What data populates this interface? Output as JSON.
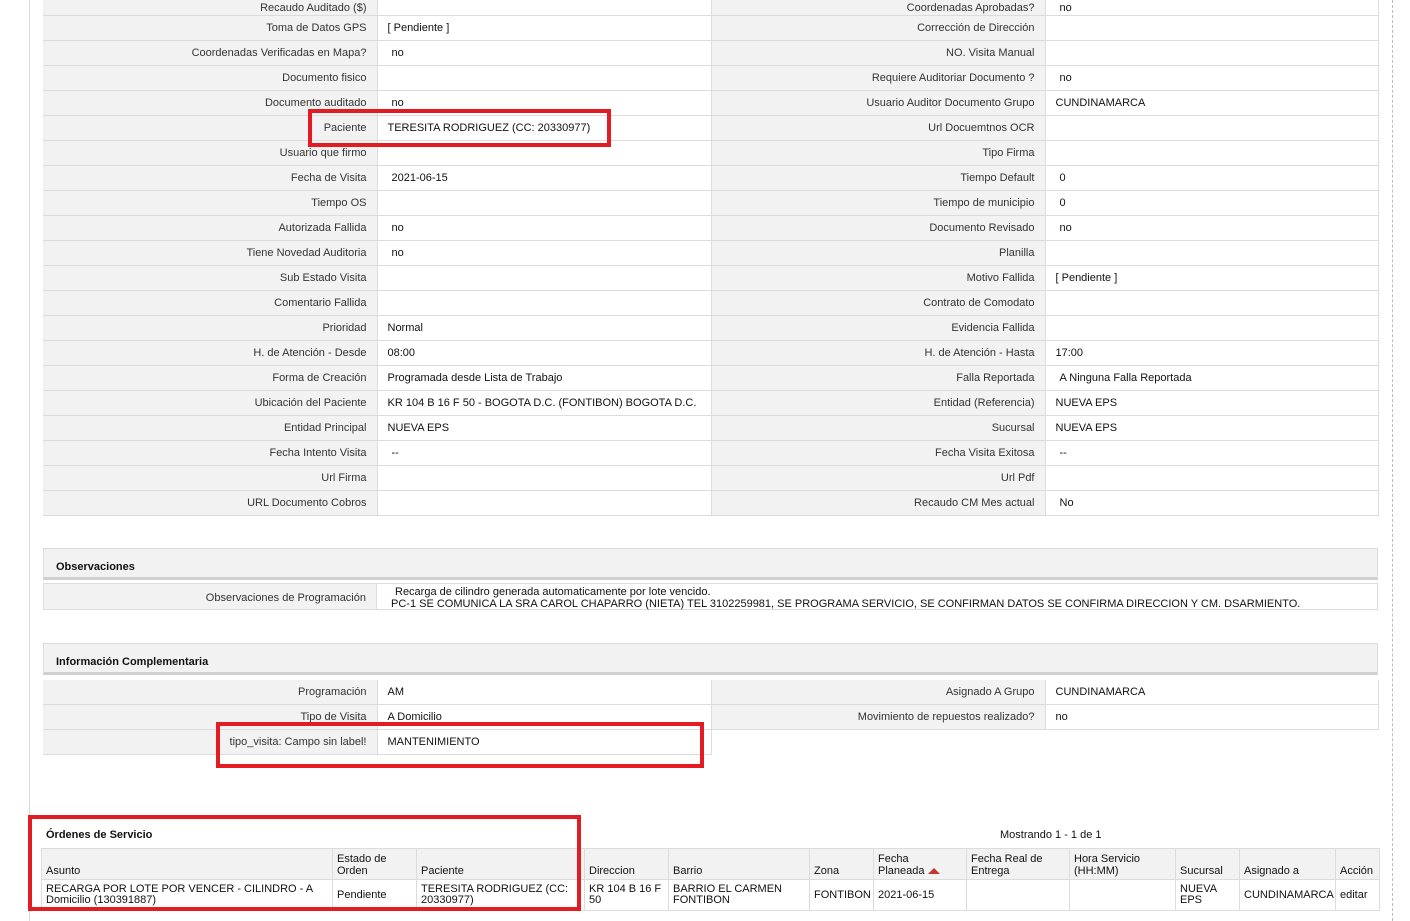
{
  "detail_rows": [
    {
      "l1": "Recaudo Auditado ($)",
      "v1": "",
      "l2": "Coordenadas Aprobadas?",
      "v2": "no"
    },
    {
      "l1": "Toma de Datos GPS",
      "v1": "[ Pendiente ]",
      "l2": "Corrección de Dirección",
      "v2": ""
    },
    {
      "l1": "Coordenadas Verificadas en Mapa?",
      "v1": "no",
      "l2": "NO. Visita Manual",
      "v2": ""
    },
    {
      "l1": "Documento fisico",
      "v1": "",
      "l2": "Requiere Auditoriar Documento ?",
      "v2": "no"
    },
    {
      "l1": "Documento auditado",
      "v1": "no",
      "l2": "Usuario Auditor Documento Grupo",
      "v2": "CUNDINAMARCA"
    },
    {
      "l1": "Paciente",
      "v1": "TERESITA RODRIGUEZ (CC: 20330977)",
      "l2": "Url Docuemtnos OCR",
      "v2": ""
    },
    {
      "l1": "Usuario que firmo",
      "v1": "",
      "l2": "Tipo Firma",
      "v2": ""
    },
    {
      "l1": "Fecha de Visita",
      "v1": "2021-06-15",
      "l2": "Tiempo Default",
      "v2": "0"
    },
    {
      "l1": "Tiempo OS",
      "v1": "",
      "l2": "Tiempo de municipio",
      "v2": "0"
    },
    {
      "l1": "Autorizada Fallida",
      "v1": "no",
      "l2": "Documento Revisado",
      "v2": "no"
    },
    {
      "l1": "Tiene Novedad Auditoria",
      "v1": "no",
      "l2": "Planilla",
      "v2": ""
    },
    {
      "l1": "Sub Estado Visita",
      "v1": "",
      "l2": "Motivo Fallida",
      "v2": "[ Pendiente ]"
    },
    {
      "l1": "Comentario Fallida",
      "v1": "",
      "l2": "Contrato de Comodato",
      "v2": ""
    },
    {
      "l1": "Prioridad",
      "v1": "Normal",
      "l2": "Evidencia Fallida",
      "v2": ""
    },
    {
      "l1": "H. de Atención - Desde",
      "v1": "08:00",
      "l2": "H. de Atención - Hasta",
      "v2": "17:00"
    },
    {
      "l1": "Forma de Creación",
      "v1": "Programada desde Lista de Trabajo",
      "l2": "Falla Reportada",
      "v2": "A Ninguna Falla Reportada"
    },
    {
      "l1": "Ubicación del Paciente",
      "v1": "KR 104 B 16 F 50 - BOGOTA D.C. (FONTIBON) BOGOTA D.C.",
      "l2": "Entidad (Referencia)",
      "v2": "NUEVA EPS"
    },
    {
      "l1": "Entidad Principal",
      "v1": "NUEVA EPS",
      "l2": "Sucursal",
      "v2": "NUEVA EPS"
    },
    {
      "l1": "Fecha Intento Visita",
      "v1": "--",
      "l2": "Fecha Visita Exitosa",
      "v2": "--"
    },
    {
      "l1": "Url Firma",
      "v1": "",
      "l2": "Url Pdf",
      "v2": ""
    },
    {
      "l1": "URL Documento Cobros",
      "v1": "",
      "l2": "Recaudo CM Mes actual",
      "v2": "No"
    }
  ],
  "observaciones": {
    "title": "Observaciones",
    "label": "Observaciones de Programación",
    "line1": "Recarga de cilindro generada automaticamente por lote vencido.",
    "line2": "PC-1 SE COMUNICA LA SRA CAROL CHAPARRO (NIETA) TEL 3102259981, SE PROGRAMA SERVICIO, SE CONFIRMAN DATOS SE CONFIRMA DIRECCION Y CM. DSARMIENTO."
  },
  "info": {
    "title": "Información Complementaria",
    "rows": [
      {
        "l1": "Programación",
        "v1": "AM",
        "l2": "Asignado A Grupo",
        "v2": "CUNDINAMARCA"
      },
      {
        "l1": "Tipo de Visita",
        "v1": "A Domicilio",
        "l2": "Movimiento de repuestos realizado?",
        "v2": "no"
      }
    ],
    "extra_label": "tipo_visita: Campo sin label!",
    "extra_value": "MANTENIMIENTO"
  },
  "orders": {
    "title": "Órdenes de Servicio",
    "count_text": "Mostrando 1 - 1 de 1",
    "headers": {
      "asunto": "Asunto",
      "estado_1": "Estado de",
      "estado_2": "Orden",
      "paciente": "Paciente",
      "direccion": "Direccion",
      "barrio": "Barrio",
      "zona": "Zona",
      "fecha_plan_1": "Fecha",
      "fecha_plan_2": "Planeada",
      "fecha_real_1": "Fecha Real de",
      "fecha_real_2": "Entrega",
      "hora_1": "Hora Servicio",
      "hora_2": "(HH:MM)",
      "sucursal": "Sucursal",
      "asignado": "Asignado a",
      "accion": "Acción"
    },
    "row": {
      "asunto_1": "RECARGA POR LOTE POR VENCER - CILINDRO - A",
      "asunto_2": "Domicilio (130391887)",
      "estado": "Pendiente",
      "paciente_1": "TERESITA RODRIGUEZ (CC:",
      "paciente_2": "20330977)",
      "direccion_1": "KR 104 B 16 F",
      "direccion_2": "50",
      "barrio_1": "BARRIO EL CARMEN",
      "barrio_2": "FONTIBON",
      "zona": "FONTIBON",
      "fecha_plan": "2021-06-15",
      "fecha_real": "",
      "hora": "",
      "sucursal_1": "NUEVA",
      "sucursal_2": "EPS",
      "asignado": "CUNDINAMARCA",
      "accion": "editar"
    }
  },
  "colors": {
    "highlight": "#e31b23",
    "label_bg": "#f2f2f2",
    "border": "#dcdcdc"
  }
}
